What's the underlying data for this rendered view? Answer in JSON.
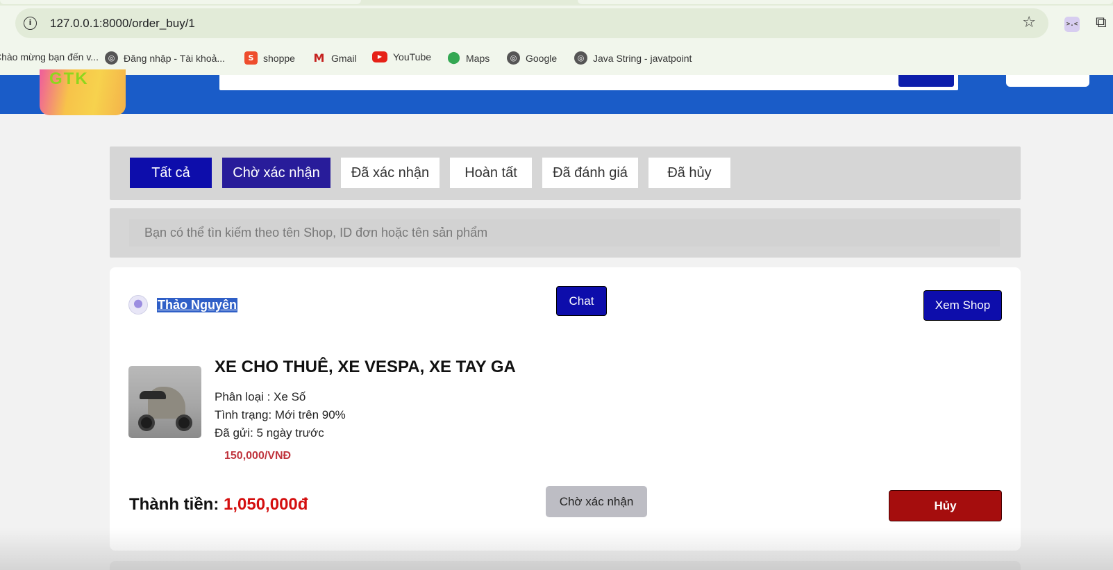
{
  "browser": {
    "url": "127.0.0.1:8000/order_buy/1",
    "bookmarks": [
      {
        "label": "Chào mừng bạn đến v...",
        "icon": "page-icon"
      },
      {
        "label": "Đăng nhập - Tài khoả...",
        "icon": "globe-icon"
      },
      {
        "label": "shoppe",
        "icon": "shopee-icon"
      },
      {
        "label": "Gmail",
        "icon": "gmail-icon"
      },
      {
        "label": "YouTube",
        "icon": "youtube-icon"
      },
      {
        "label": "Maps",
        "icon": "maps-icon"
      },
      {
        "label": "Google",
        "icon": "globe-icon"
      },
      {
        "label": "Java String - javatpoint",
        "icon": "globe-icon"
      }
    ]
  },
  "site": {
    "logo_text": "GTK",
    "colors": {
      "header": "#1a5cc8",
      "primary_button": "#0d0dab",
      "price": "#d40f0f",
      "cancel": "#a50d0d"
    }
  },
  "tabs": [
    {
      "label": "Tất cả",
      "state": "active"
    },
    {
      "label": "Chờ xác nhận",
      "state": "active"
    },
    {
      "label": "Đã xác nhận",
      "state": "inactive"
    },
    {
      "label": "Hoàn tất",
      "state": "inactive"
    },
    {
      "label": "Đã đánh giá",
      "state": "inactive"
    },
    {
      "label": "Đã hủy",
      "state": "inactive"
    }
  ],
  "search": {
    "placeholder": "Bạn có thể tìn kiếm theo tên Shop, ID đơn hoặc tên sản phẩm"
  },
  "order": {
    "shop_name": "Thảo Nguyên",
    "chat_label": "Chat",
    "view_shop_label": "Xem Shop",
    "product": {
      "title": "XE CHO THUÊ, XE VESPA, XE TAY GA",
      "category": "Phân loại : Xe Số",
      "condition": "Tình trạng: Mới trên 90%",
      "sent": "Đã gửi: 5 ngày trước",
      "price": "150,000/VNĐ"
    },
    "total_label": "Thành tiền:",
    "total_value": "1,050,000đ",
    "status_label": "Chờ xác nhận",
    "cancel_label": "Hủy"
  }
}
